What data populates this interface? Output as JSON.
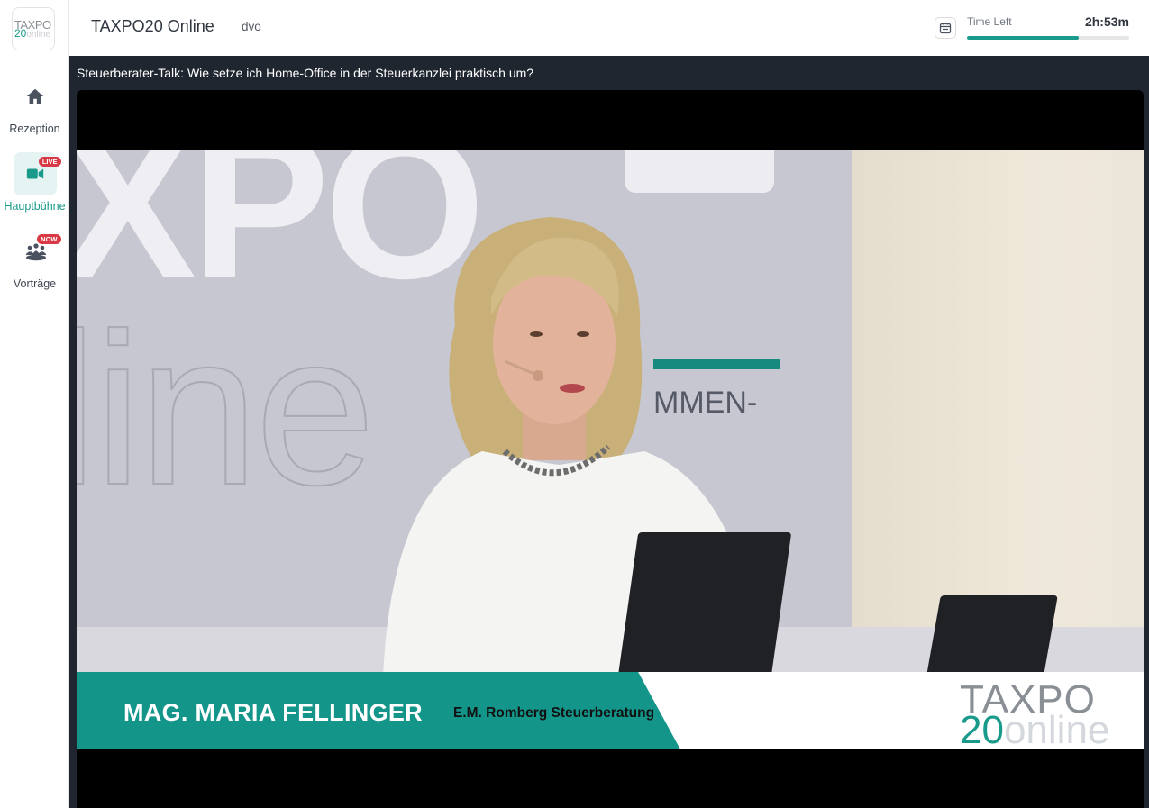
{
  "app": {
    "logo_top": "TAXPO",
    "logo_num": "20",
    "logo_sub": "online",
    "title": "TAXPO20 Online",
    "user": "dvo"
  },
  "sidebar": {
    "items": [
      {
        "label": "Rezeption",
        "icon": "home-icon",
        "badge": ""
      },
      {
        "label": "Hauptbühne",
        "icon": "video-camera-icon",
        "badge": "LIVE",
        "active": true
      },
      {
        "label": "Vorträge",
        "icon": "audience-icon",
        "badge": "NOW"
      }
    ]
  },
  "header": {
    "time_left_label": "Time Left",
    "time_left_value": "2h:53m",
    "time_left_progress_pct": 69
  },
  "stage": {
    "session_title": "Steuerberater-Talk: Wie setze ich Home-Office in der Steuerkanzlei praktisch um?",
    "video": {
      "speaker_name": "MAG. MARIA FELLINGER",
      "speaker_org": "E.M. Romberg Steuerberatung",
      "watermark_top": "TAXPO",
      "watermark_num": "20",
      "watermark_sub": "online",
      "backdrop_letters": "XPO",
      "backdrop_outline": "line",
      "backdrop_word": "MMEN-"
    }
  },
  "colors": {
    "accent": "#1a9a8a",
    "stage_bg": "#202630",
    "badge": "#d83a45"
  }
}
